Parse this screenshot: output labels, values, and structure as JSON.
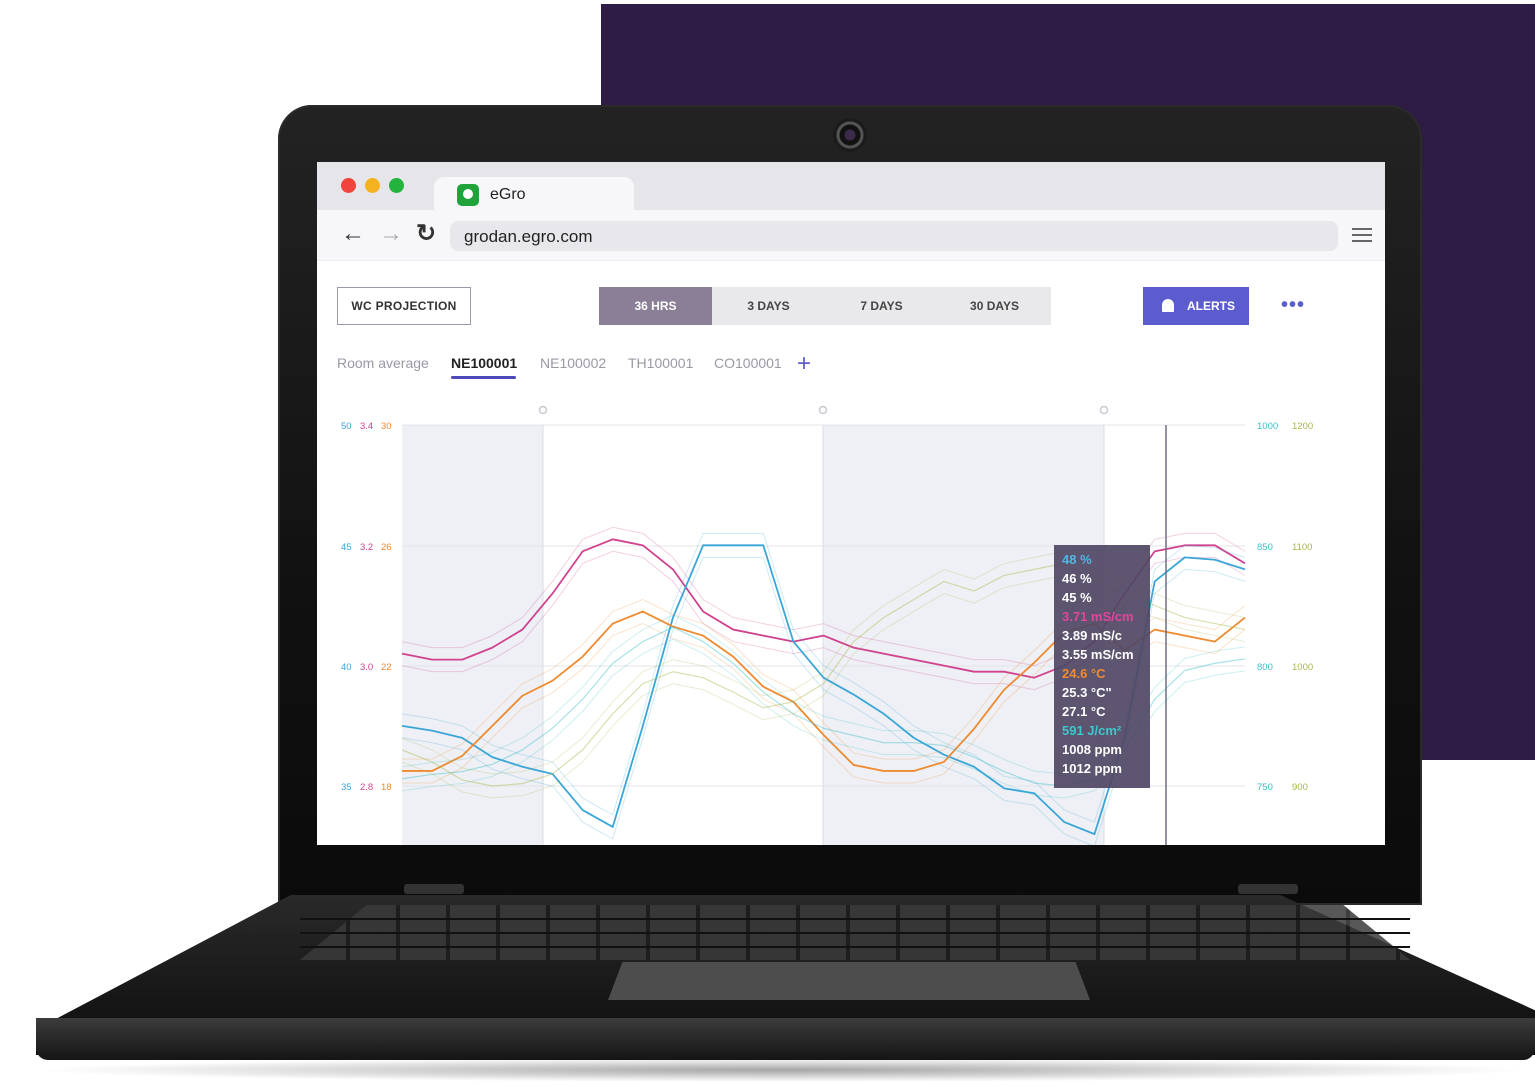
{
  "browser": {
    "tab_title": "eGro",
    "url": "grodan.egro.com"
  },
  "toolbar": {
    "wc_projection": "WC PROJECTION",
    "ranges": [
      {
        "label": "36 HRS",
        "active": true
      },
      {
        "label": "3 DAYS",
        "active": false
      },
      {
        "label": "7 DAYS",
        "active": false
      },
      {
        "label": "30 DAYS",
        "active": false
      }
    ],
    "alerts": "ALERTS",
    "more": "•••"
  },
  "sensors": {
    "tabs": [
      "Room average",
      "NE100001",
      "NE100002",
      "TH100001",
      "CO100001"
    ],
    "active": "NE100001",
    "add": "+"
  },
  "colors": {
    "blue": "#3aa6d8",
    "pink": "#d0418e",
    "orange": "#ef8a2f",
    "teal": "#3bbfc9",
    "olive": "#a8b84a",
    "accent": "#5d5ccf",
    "brand": "#2e1c45"
  },
  "chart_data": {
    "type": "line",
    "left_axes": [
      {
        "ticks": [
          "50",
          "45",
          "40",
          "35"
        ],
        "color": "#3aa6d8"
      },
      {
        "ticks": [
          "3.4",
          "3.2",
          "3.0",
          "2.8"
        ],
        "color": "#d0418e"
      },
      {
        "ticks": [
          "30",
          "26",
          "22",
          "18"
        ],
        "color": "#ef8a2f"
      }
    ],
    "right_axes": [
      {
        "ticks": [
          "1000",
          "850",
          "800",
          "750"
        ],
        "color": "#3bbfc9"
      },
      {
        "ticks": [
          "1200",
          "1100",
          "1000",
          "900"
        ],
        "color": "#a8b84a"
      }
    ],
    "series": [
      {
        "color": "#d0418e",
        "unit_axis": "3.4-2.8",
        "values": [
          3.02,
          3.01,
          3.01,
          3.03,
          3.06,
          3.12,
          3.19,
          3.21,
          3.2,
          3.16,
          3.09,
          3.06,
          3.05,
          3.04,
          3.05,
          3.03,
          3.02,
          3.01,
          3.0,
          2.99,
          2.99,
          2.98,
          3.0,
          3.04,
          3.12,
          3.19,
          3.2,
          3.2,
          3.17
        ]
      },
      {
        "color": "#3aa6d8",
        "unit_axis": "50-35",
        "values": [
          37.5,
          37.3,
          37.0,
          36.2,
          35.8,
          35.5,
          34.0,
          33.3,
          37.5,
          42.0,
          45.0,
          45.0,
          45.0,
          41.0,
          39.5,
          38.8,
          38.0,
          37.0,
          36.3,
          35.8,
          34.9,
          34.7,
          33.5,
          33.0,
          37.0,
          43.5,
          44.5,
          44.4,
          44.0
        ]
      },
      {
        "color": "#ef8a2f",
        "unit_axis": "30-18",
        "values": [
          18.5,
          18.5,
          19.0,
          20.0,
          21.0,
          21.5,
          22.3,
          23.4,
          23.8,
          23.3,
          23.0,
          22.3,
          21.3,
          20.8,
          19.7,
          18.7,
          18.5,
          18.5,
          18.8,
          19.9,
          21.2,
          22.1,
          23.1,
          23.4,
          22.5,
          23.2,
          23.0,
          22.8,
          23.6
        ]
      },
      {
        "color": "#3bbfc9",
        "unit_axis": "1000-750",
        "values": [
          755,
          758,
          760,
          765,
          775,
          790,
          810,
          835,
          850,
          860,
          850,
          835,
          815,
          800,
          790,
          785,
          780,
          780,
          778,
          770,
          760,
          752,
          750,
          755,
          775,
          810,
          830,
          835,
          838
        ]
      },
      {
        "color": "#a8b84a",
        "unit_axis": "1200-900",
        "values": [
          930,
          920,
          905,
          900,
          902,
          910,
          930,
          960,
          985,
          995,
          990,
          978,
          965,
          970,
          985,
          1020,
          1040,
          1055,
          1070,
          1062,
          1075,
          1080,
          1085,
          1070,
          1060,
          1050,
          1040,
          1035,
          1030
        ]
      }
    ],
    "tooltip": [
      {
        "text": "48 %",
        "color": "#4fb6e8"
      },
      {
        "text": "46 %",
        "color": "#ffffff"
      },
      {
        "text": "45 %",
        "color": "#ffffff"
      },
      {
        "text": "3.71 mS/cm",
        "color": "#e0469a"
      },
      {
        "text": "3.89 mS/c",
        "color": "#ffffff"
      },
      {
        "text": "3.55 mS/cm",
        "color": "#ffffff"
      },
      {
        "text": "24.6 °C",
        "color": "#f28a2e"
      },
      {
        "text": "25.3 °C\"",
        "color": "#ffffff"
      },
      {
        "text": "27.1 °C",
        "color": "#ffffff"
      },
      {
        "text": "591 J/cm²",
        "color": "#3cc8cf"
      },
      {
        "text": "1008 ppm",
        "color": "#ffffff"
      },
      {
        "text": "1012 ppm",
        "color": "#ffffff"
      }
    ]
  }
}
